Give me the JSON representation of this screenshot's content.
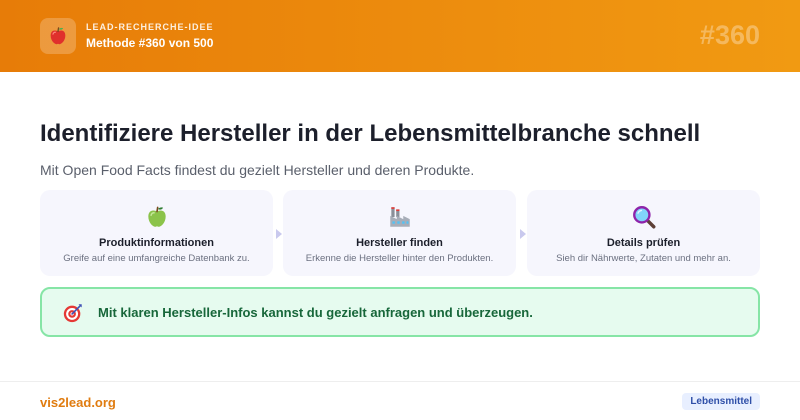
{
  "header": {
    "kicker": "LEAD-RECHERCHE-IDEE",
    "method": "Methode #360 von 500",
    "number": "#360",
    "logo_icon": "apple-icon"
  },
  "main": {
    "title": "Identifiziere Hersteller in der Lebensmittelbranche schnell",
    "subtitle": "Mit Open Food Facts findest du gezielt Hersteller und deren Produkte.",
    "cards": [
      {
        "icon": "green-apple-icon",
        "title": "Produktinformationen",
        "desc": "Greife auf eine umfangreiche Datenbank zu."
      },
      {
        "icon": "factory-icon",
        "title": "Hersteller finden",
        "desc": "Erkenne die Hersteller hinter den Produkten."
      },
      {
        "icon": "magnifier-icon",
        "title": "Details prüfen",
        "desc": "Sieh dir Nährwerte, Zutaten und mehr an."
      }
    ],
    "callout": {
      "icon": "target-icon",
      "text": "Mit klaren Hersteller-Infos kannst du gezielt anfragen und überzeugen."
    }
  },
  "footer": {
    "brand": "vis2lead.org",
    "tag": "Lebensmittel"
  },
  "colors": {
    "header_start": "#e77c08",
    "header_end": "#f19a12",
    "callout_bg": "#e6fbef",
    "callout_border": "#86e5a6",
    "callout_text": "#17673a",
    "brand": "#e07c10",
    "tag_bg": "#e8efff",
    "tag_text": "#2f4fa8"
  }
}
